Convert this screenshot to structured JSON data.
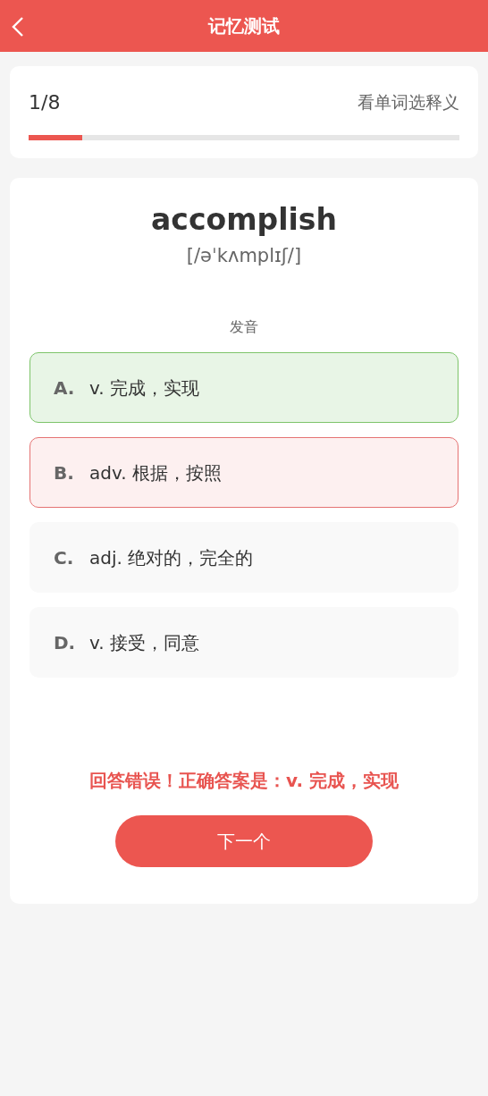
{
  "header": {
    "title": "记忆测试"
  },
  "progress": {
    "counter": "1/8",
    "mode": "看单词选释义",
    "level": 0.125
  },
  "word": {
    "text": "accomplish",
    "phonetic": "[/əˈkʌmplɪʃ/]",
    "pronounce": "发音"
  },
  "options": [
    {
      "letter": "A.",
      "text": "v. 完成，实现",
      "kind": "correct"
    },
    {
      "letter": "B.",
      "text": "adv. 根据，按照",
      "kind": "wrong"
    },
    {
      "letter": "C.",
      "text": "adj. 绝对的，完全的",
      "kind": "neutral"
    },
    {
      "letter": "D.",
      "text": "v. 接受，同意",
      "kind": "neutral"
    }
  ],
  "feedback": "回答错误！正确答案是：v. 完成，实现",
  "next_button": "下一个"
}
